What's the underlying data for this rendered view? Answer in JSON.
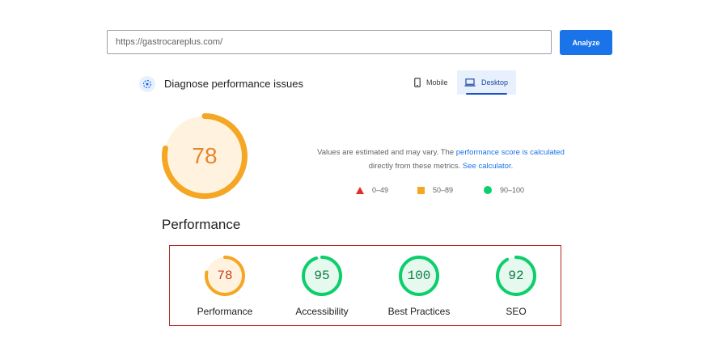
{
  "search": {
    "url": "https://gastrocareplus.com/",
    "analyze_label": "Analyze"
  },
  "header": {
    "title": "Diagnose performance issues",
    "tabs": [
      {
        "label": "Mobile",
        "selected": false
      },
      {
        "label": "Desktop",
        "selected": true
      }
    ]
  },
  "main_score": {
    "value": 78,
    "color": "#f5a623",
    "text_color": "#e8862b"
  },
  "note": {
    "text1": "Values are estimated and may vary. The ",
    "link1": "performance score is calculated",
    "text2": "directly from these metrics. ",
    "link2": "See calculator",
    "text3": "."
  },
  "legend": {
    "fail": "0–49",
    "average": "50–89",
    "pass": "90–100",
    "colors": {
      "fail": "#e02d2d",
      "average": "#f5a623",
      "pass": "#0cce6b"
    }
  },
  "section_title": "Performance",
  "categories": [
    {
      "label": "Performance",
      "score": 78,
      "ring_color": "#f5a623",
      "fill_color": "#fff3e0",
      "text_color": "#c7401d"
    },
    {
      "label": "Accessibility",
      "score": 95,
      "ring_color": "#0cce6b",
      "fill_color": "#e6f9ef",
      "text_color": "#0b7a43"
    },
    {
      "label": "Best Practices",
      "score": 100,
      "ring_color": "#0cce6b",
      "fill_color": "#e6f9ef",
      "text_color": "#0b7a43"
    },
    {
      "label": "SEO",
      "score": 92,
      "ring_color": "#0cce6b",
      "fill_color": "#e6f9ef",
      "text_color": "#0b7a43"
    }
  ]
}
